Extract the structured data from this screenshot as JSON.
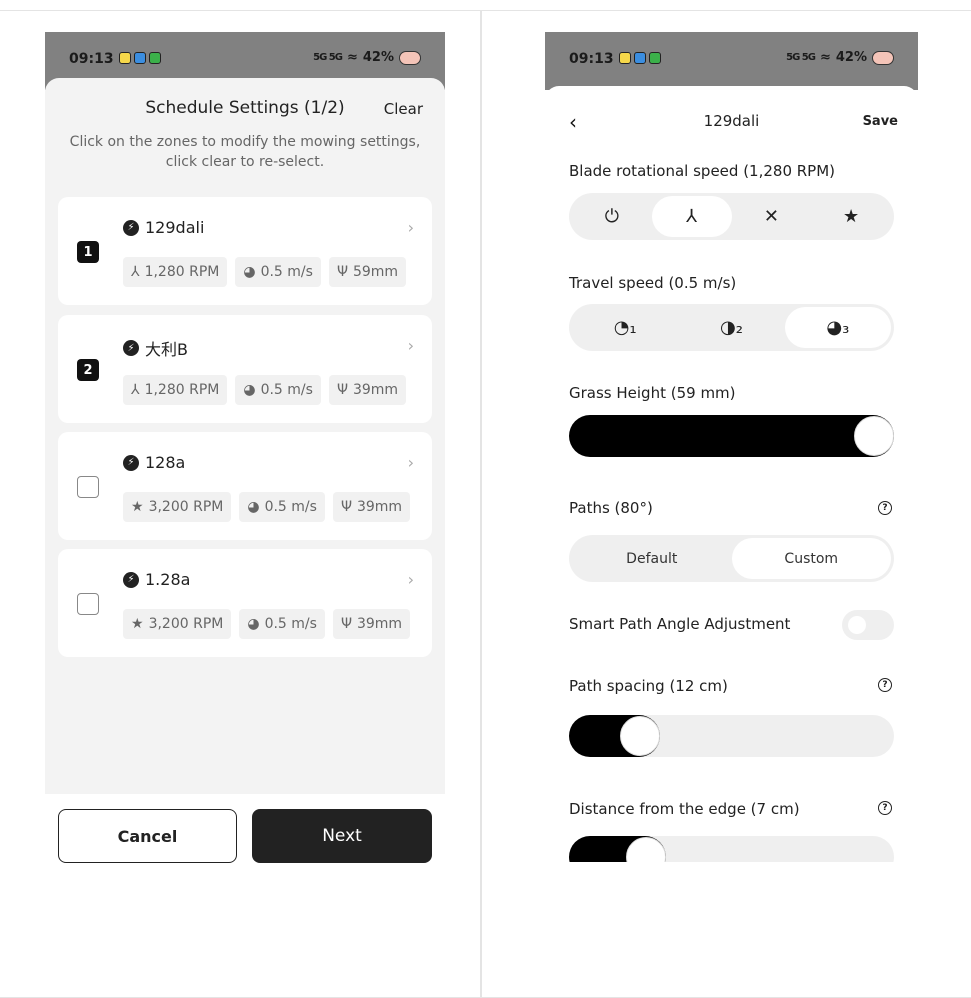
{
  "left": {
    "status": {
      "time": "09:13",
      "signal": "5G 5G",
      "battery": "42%"
    },
    "title": "Schedule Settings (1/2)",
    "clear_label": "Clear",
    "instructions": "Click on the zones to modify the mowing settings, click clear to re-select.",
    "zones": [
      {
        "index": "1",
        "name": "129dali",
        "rpm": "1,280 RPM",
        "speed": "0.5 m/s",
        "height": "59mm",
        "selected": true
      },
      {
        "index": "2",
        "name": "大利B",
        "rpm": "1,280 RPM",
        "speed": "0.5 m/s",
        "height": "39mm",
        "selected": true
      },
      {
        "index": "",
        "name": "128a",
        "rpm": "3,200 RPM",
        "speed": "0.5 m/s",
        "height": "39mm",
        "selected": false
      },
      {
        "index": "",
        "name": "1.28a",
        "rpm": "3,200 RPM",
        "speed": "0.5 m/s",
        "height": "39mm",
        "selected": false
      }
    ],
    "cancel_label": "Cancel",
    "next_label": "Next"
  },
  "right": {
    "status": {
      "time": "09:13",
      "signal": "5G 5G",
      "battery": "42%"
    },
    "title": "129dali",
    "save_label": "Save",
    "blade_label": "Blade rotational speed (1,280 RPM)",
    "blade_selected_index": 1,
    "travel_label": "Travel speed (0.5 m/s)",
    "travel_selected_index": 2,
    "grass_label": "Grass Height (59 mm)",
    "grass_value_fraction": 1.0,
    "paths_label": "Paths (80°)",
    "paths_options": [
      "Default",
      "Custom"
    ],
    "paths_selected": "Custom",
    "smart_label": "Smart Path Angle Adjustment",
    "smart_enabled": false,
    "spacing_label": "Path spacing (12 cm)",
    "spacing_value_fraction": 0.18,
    "edge_label": "Distance from the edge (7 cm)",
    "edge_value_fraction": 0.2
  }
}
